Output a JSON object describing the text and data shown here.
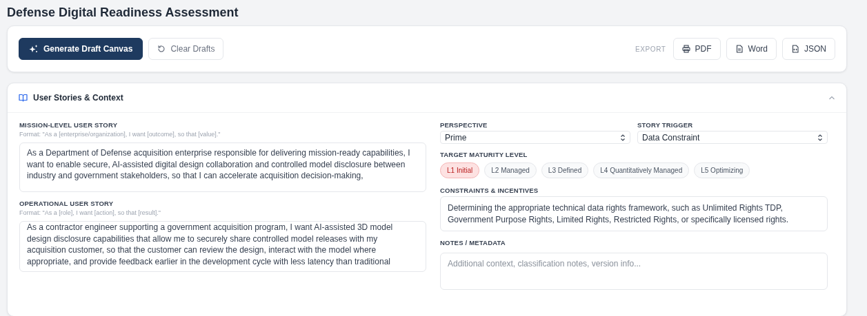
{
  "title": "Defense Digital Readiness Assessment",
  "toolbar": {
    "primary": "Generate Draft Canvas",
    "secondary": "Clear Drafts",
    "export_label": "EXPORT",
    "exports": [
      {
        "kind": "pdf",
        "label": "PDF"
      },
      {
        "kind": "word",
        "label": "Word"
      },
      {
        "kind": "json",
        "label": "JSON"
      }
    ]
  },
  "section": {
    "title": "User Stories & Context",
    "expanded": true,
    "mission": {
      "label": "MISSION-LEVEL USER STORY",
      "hint": "Format: \"As a [enterprise/organization], I want [outcome], so that [value].\"",
      "value": "As a Department of Defense acquisition enterprise responsible for delivering mission-ready capabilities, I want to enable secure, AI-assisted digital design collaboration and controlled model disclosure between industry and government stakeholders, so that I can accelerate acquisition decision-making,"
    },
    "operational": {
      "label": "OPERATIONAL USER STORY",
      "hint": "Format: \"As a [role], I want [action], so that [result].\"",
      "value": "As a contractor engineer supporting a government acquisition program, I want AI-assisted 3D model design disclosure capabilities that allow me to securely share controlled model releases with my acquisition customer, so that the customer can review the design, interact with the model where appropriate, and provide feedback earlier in the development cycle with less latency than traditional"
    },
    "perspective": {
      "label": "PERSPECTIVE",
      "value": "Prime"
    },
    "trigger": {
      "label": "STORY TRIGGER",
      "value": "Data Constraint"
    },
    "maturity": {
      "label": "TARGET MATURITY LEVEL",
      "levels": [
        {
          "label": "L1 Initial",
          "selected": true
        },
        {
          "label": "L2 Managed",
          "selected": false
        },
        {
          "label": "L3 Defined",
          "selected": false
        },
        {
          "label": "L4 Quantitatively Managed",
          "selected": false
        },
        {
          "label": "L5 Optimizing",
          "selected": false
        }
      ]
    },
    "constraints": {
      "label": "CONSTRAINTS & INCENTIVES",
      "value": "Determining the appropriate technical data rights framework, such as Unlimited Rights TDP, Government Purpose Rights, Limited Rights, Restricted Rights, or specifically licensed rights."
    },
    "notes": {
      "label": "NOTES / METADATA",
      "placeholder": "Additional context, classification notes, version info..."
    }
  }
}
